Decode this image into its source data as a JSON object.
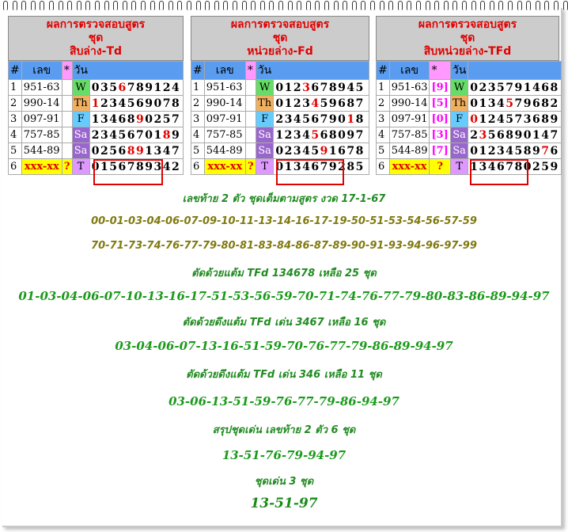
{
  "panels": [
    {
      "title": [
        "ผลการตรวจสอบสูตร",
        "ชุด",
        "สิบล่าง-Td"
      ],
      "header": {
        "hash": "#",
        "num": "เลข",
        "star": "*",
        "day": "วัน"
      },
      "rows": [
        {
          "idx": "1",
          "num": "951-63",
          "day": "W",
          "digits": [
            "0",
            "3",
            "5",
            "6",
            "7",
            "8",
            "9",
            "1",
            "2",
            "4"
          ],
          "red": [
            3
          ]
        },
        {
          "idx": "2",
          "num": "990-14",
          "day": "Th",
          "digits": [
            "1",
            "2",
            "3",
            "4",
            "5",
            "6",
            "9",
            "0",
            "7",
            "8"
          ],
          "red": [
            0
          ]
        },
        {
          "idx": "3",
          "num": "097-91",
          "day": "F",
          "digits": [
            "1",
            "3",
            "4",
            "6",
            "8",
            "9",
            "0",
            "2",
            "5",
            "7"
          ],
          "red": [
            5
          ]
        },
        {
          "idx": "4",
          "num": "757-85",
          "day": "Sa",
          "digits": [
            "2",
            "3",
            "4",
            "5",
            "6",
            "7",
            "0",
            "1",
            "8",
            "9"
          ],
          "red": [
            8
          ]
        },
        {
          "idx": "5",
          "num": "544-89",
          "day": "Sa",
          "digits": [
            "0",
            "2",
            "5",
            "6",
            "8",
            "9",
            "1",
            "3",
            "4",
            "7"
          ],
          "red": [
            4,
            5
          ]
        },
        {
          "idx": "6",
          "num": "xxx-xx",
          "q": "?",
          "day": "T",
          "digits": [
            "0",
            "1",
            "5",
            "6",
            "7",
            "8",
            "9",
            "3",
            "4",
            "2"
          ],
          "red": []
        }
      ]
    },
    {
      "title": [
        "ผลการตรวจสอบสูตร",
        "ชุด",
        "หน่วยล่าง-Fd"
      ],
      "header": {
        "hash": "#",
        "num": "เลข",
        "star": "*",
        "day": "วัน"
      },
      "rows": [
        {
          "idx": "1",
          "num": "951-63",
          "day": "W",
          "digits": [
            "0",
            "1",
            "2",
            "3",
            "6",
            "7",
            "8",
            "9",
            "4",
            "5"
          ],
          "red": [
            3
          ]
        },
        {
          "idx": "2",
          "num": "990-14",
          "day": "Th",
          "digits": [
            "0",
            "1",
            "2",
            "3",
            "4",
            "5",
            "9",
            "6",
            "8",
            "7"
          ],
          "red": [
            4
          ]
        },
        {
          "idx": "3",
          "num": "097-91",
          "day": "F",
          "digits": [
            "2",
            "3",
            "4",
            "5",
            "6",
            "7",
            "9",
            "0",
            "1",
            "8"
          ],
          "red": [
            8
          ]
        },
        {
          "idx": "4",
          "num": "757-85",
          "day": "Sa",
          "digits": [
            "1",
            "2",
            "3",
            "4",
            "5",
            "6",
            "8",
            "0",
            "9",
            "7"
          ],
          "red": [
            4
          ]
        },
        {
          "idx": "5",
          "num": "544-89",
          "day": "Sa",
          "digits": [
            "0",
            "2",
            "3",
            "4",
            "5",
            "9",
            "1",
            "6",
            "7",
            "8"
          ],
          "red": [
            5
          ]
        },
        {
          "idx": "6",
          "num": "xxx-xx",
          "q": "?",
          "day": "T",
          "digits": [
            "0",
            "1",
            "3",
            "4",
            "6",
            "7",
            "9",
            "2",
            "8",
            "5"
          ],
          "red": []
        }
      ]
    },
    {
      "title": [
        "ผลการตรวจสอบสูตร",
        "ชุด",
        "สิบหน่วยล่าง-TFd"
      ],
      "header": {
        "hash": "#",
        "num": "เลข",
        "star": "*",
        "day": "วัน"
      },
      "rows": [
        {
          "idx": "1",
          "num": "951-63",
          "br": "[9]",
          "day": "W",
          "digits": [
            "0",
            "2",
            "3",
            "5",
            "7",
            "9",
            "1",
            "4",
            "6",
            "8"
          ],
          "red": []
        },
        {
          "idx": "2",
          "num": "990-14",
          "br": "[5]",
          "day": "Th",
          "digits": [
            "0",
            "1",
            "3",
            "4",
            "5",
            "7",
            "9",
            "6",
            "8",
            "2"
          ],
          "red": [
            4
          ]
        },
        {
          "idx": "3",
          "num": "097-91",
          "br": "[0]",
          "day": "F",
          "digits": [
            "0",
            "1",
            "2",
            "4",
            "5",
            "7",
            "3",
            "6",
            "8",
            "9"
          ],
          "red": [
            0
          ]
        },
        {
          "idx": "4",
          "num": "757-85",
          "br": "[3]",
          "day": "Sa",
          "digits": [
            "2",
            "3",
            "5",
            "6",
            "8",
            "9",
            "0",
            "1",
            "4",
            "7"
          ],
          "red": [
            1
          ]
        },
        {
          "idx": "5",
          "num": "544-89",
          "br": "[7]",
          "day": "Sa",
          "digits": [
            "0",
            "1",
            "2",
            "3",
            "4",
            "5",
            "8",
            "9",
            "7",
            "6"
          ],
          "red": [
            8
          ]
        },
        {
          "idx": "6",
          "num": "xxx-xx",
          "br": "?",
          "day": "T",
          "digits": [
            "1",
            "3",
            "4",
            "6",
            "7",
            "8",
            "0",
            "2",
            "5",
            "9"
          ],
          "red": []
        }
      ]
    }
  ],
  "lines": [
    {
      "text": "เลขท้าย 2 ตัว ชุดเต็มตามสูตร งวด 17-1-67",
      "cls": "g1"
    },
    {
      "text": "00-01-03-04-06-07-09-10-11-13-14-16-17-19-50-51-53-54-56-57-59",
      "cls": "ol"
    },
    {
      "text": "70-71-73-74-76-77-79-80-81-83-84-86-87-89-90-91-93-94-96-97-99",
      "cls": "ol"
    },
    {
      "text": "ตัดด้วยแต้ม TFd 134678 เหลือ 25 ชุด",
      "cls": "g1"
    },
    {
      "text": "01-03-04-06-07-10-13-16-17-51-53-56-59-70-71-74-76-77-79-80-83-86-89-94-97",
      "cls": "g2"
    },
    {
      "text": "ตัดด้วยดึงแต้ม TFd เด่น 3467 เหลือ 16 ชุด",
      "cls": "g1"
    },
    {
      "text": "03-04-06-07-13-16-51-59-70-76-77-79-86-89-94-97",
      "cls": "g2"
    },
    {
      "text": "ตัดด้วยดึงแต้ม TFd เด่น 346 เหลือ 11 ชุด",
      "cls": "g1"
    },
    {
      "text": "03-06-13-51-59-76-77-79-86-94-97",
      "cls": "g2"
    },
    {
      "text": "สรุปชุดเด่น เลขท้าย 2 ตัว 6 ชุด",
      "cls": "g1"
    },
    {
      "text": "13-51-76-79-94-97",
      "cls": "g2"
    },
    {
      "text": "ชุดเด่น 3 ชุด",
      "cls": "g1"
    },
    {
      "text": "13-51-97",
      "cls": "g3"
    }
  ]
}
